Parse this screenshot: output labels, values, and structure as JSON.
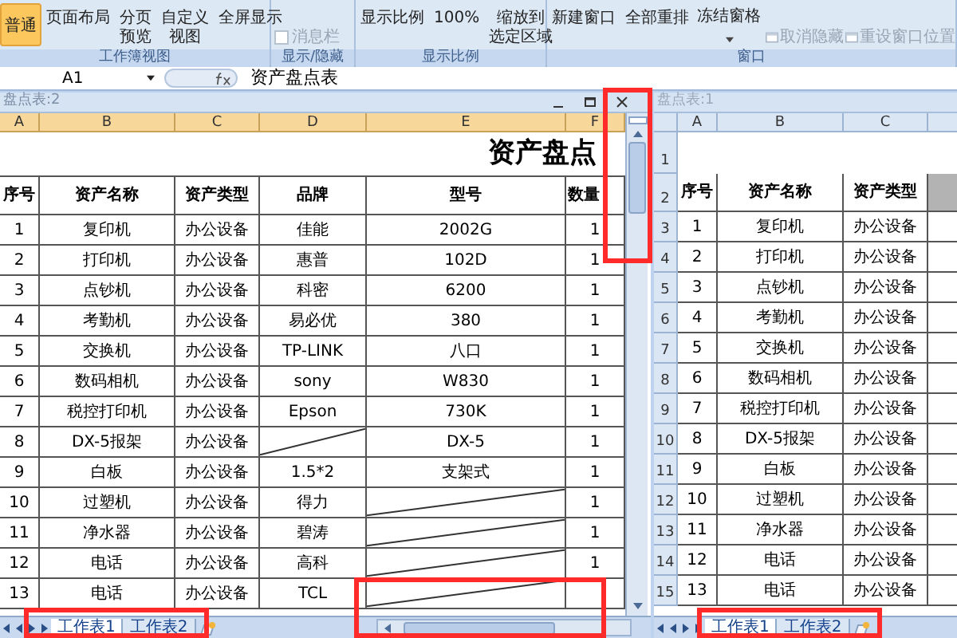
{
  "ribbon": {
    "groups": [
      {
        "label": "工作簿视图",
        "items": [
          {
            "kind": "large",
            "label": "普通",
            "selected": true
          },
          {
            "kind": "large",
            "label": "页面布局",
            "selected": false
          },
          {
            "kind": "stacked",
            "lines": [
              "分页",
              "预览"
            ],
            "selected": false
          },
          {
            "kind": "stacked",
            "lines": [
              "自定义",
              "视图"
            ],
            "selected": false
          },
          {
            "kind": "large",
            "label": "全屏显示",
            "selected": false
          }
        ]
      },
      {
        "label": "显示/隐藏",
        "items": [
          {
            "kind": "check",
            "label": "消息栏",
            "checked": false,
            "disabled": true
          }
        ]
      },
      {
        "label": "显示比例",
        "items": [
          {
            "kind": "large",
            "label": "显示比例",
            "selected": false
          },
          {
            "kind": "large",
            "label": "100%",
            "selected": false
          },
          {
            "kind": "stacked",
            "lines": [
              "缩放到",
              "选定区域"
            ],
            "selected": false
          }
        ]
      },
      {
        "label": "窗口",
        "items": [
          {
            "kind": "large",
            "label": "新建窗口",
            "selected": false
          },
          {
            "kind": "large",
            "label": "全部重排",
            "selected": false
          },
          {
            "kind": "dropdown",
            "label": "冻结窗格"
          },
          {
            "kind": "small",
            "label": "取消隐藏",
            "disabled": true
          },
          {
            "kind": "small",
            "label": "重设窗口位置",
            "disabled": true
          }
        ]
      }
    ]
  },
  "formula_bar": {
    "name_box": "A1",
    "formula": "资产盘点表"
  },
  "left_window": {
    "title": "盘点表:2",
    "column_headers": [
      "A",
      "B",
      "C",
      "D",
      "E",
      "F"
    ],
    "title_row": "资产盘点",
    "header": [
      "序号",
      "资产名称",
      "资产类型",
      "品牌",
      "型号",
      "数量"
    ],
    "rows": [
      [
        "1",
        "复印机",
        "办公设备",
        "佳能",
        "2002G",
        "1"
      ],
      [
        "2",
        "打印机",
        "办公设备",
        "惠普",
        "102D",
        "1"
      ],
      [
        "3",
        "点钞机",
        "办公设备",
        "科密",
        "6200",
        "1"
      ],
      [
        "4",
        "考勤机",
        "办公设备",
        "易必优",
        "380",
        "1"
      ],
      [
        "5",
        "交换机",
        "办公设备",
        "TP-LINK",
        "八口",
        "1"
      ],
      [
        "6",
        "数码相机",
        "办公设备",
        "sony",
        "W830",
        "1"
      ],
      [
        "7",
        "税控打印机",
        "办公设备",
        "Epson",
        "730K",
        "1"
      ],
      [
        "8",
        "DX-5报架",
        "办公设备",
        {
          "kind": "slash"
        },
        "DX-5",
        "1"
      ],
      [
        "9",
        "白板",
        "办公设备",
        "1.5*2",
        "支架式",
        "1"
      ],
      [
        "10",
        "过塑机",
        "办公设备",
        "得力",
        {
          "kind": "slash"
        },
        "1"
      ],
      [
        "11",
        "净水器",
        "办公设备",
        "碧涛",
        {
          "kind": "slash"
        },
        "1"
      ],
      [
        "12",
        "电话",
        "办公设备",
        "高科",
        {
          "kind": "slash"
        },
        "1"
      ],
      [
        "13",
        "电话",
        "办公设备",
        "TCL",
        {
          "kind": "slash"
        },
        null
      ]
    ],
    "sheet_tabs": [
      {
        "label": "工作表1",
        "selected": true
      },
      {
        "label": "工作表2",
        "selected": false
      }
    ]
  },
  "right_window": {
    "title": "盘点表:1",
    "column_headers": [
      "A",
      "B",
      "C"
    ],
    "row_headers": [
      "1",
      "2",
      "3",
      "4",
      "5",
      "6",
      "7",
      "8",
      "9",
      "10",
      "11",
      "12",
      "13",
      "14",
      "15"
    ],
    "header": [
      "序号",
      "资产名称",
      "资产类型"
    ],
    "rows": [
      [
        "1",
        "复印机",
        "办公设备"
      ],
      [
        "2",
        "打印机",
        "办公设备"
      ],
      [
        "3",
        "点钞机",
        "办公设备"
      ],
      [
        "4",
        "考勤机",
        "办公设备"
      ],
      [
        "5",
        "交换机",
        "办公设备"
      ],
      [
        "6",
        "数码相机",
        "办公设备"
      ],
      [
        "7",
        "税控打印机",
        "办公设备"
      ],
      [
        "8",
        "DX-5报架",
        "办公设备"
      ],
      [
        "9",
        "白板",
        "办公设备"
      ],
      [
        "10",
        "过塑机",
        "办公设备"
      ],
      [
        "11",
        "净水器",
        "办公设备"
      ],
      [
        "12",
        "电话",
        "办公设备"
      ],
      [
        "13",
        "电话",
        "办公设备"
      ]
    ],
    "sheet_tabs": [
      {
        "label": "工作表1",
        "selected": true
      },
      {
        "label": "工作表2",
        "selected": false
      }
    ]
  }
}
